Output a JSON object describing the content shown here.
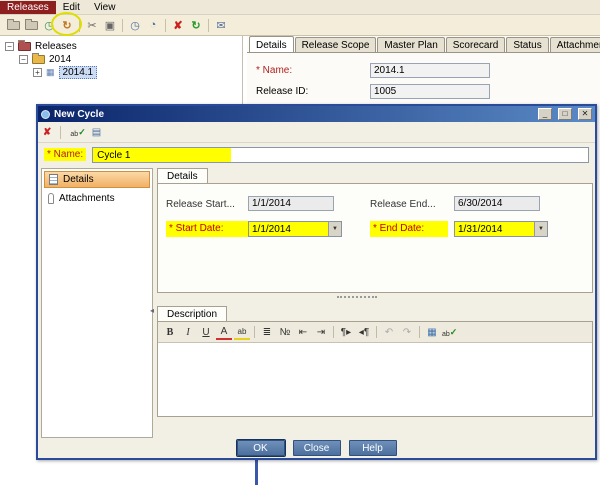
{
  "menu": {
    "releases": "Releases",
    "edit": "Edit",
    "view": "View"
  },
  "main_tabs": {
    "details": "Details",
    "release_scope": "Release Scope",
    "master_plan": "Master Plan",
    "scorecard": "Scorecard",
    "status": "Status",
    "attachments": "Attachments"
  },
  "tree": {
    "root": "Releases",
    "folder_2014": "2014",
    "release_2014_1": "2014.1"
  },
  "release_details": {
    "name_label": "* Name:",
    "name_value": "2014.1",
    "release_id_label": "Release ID:",
    "release_id_value": "1005"
  },
  "dialog": {
    "title": "New Cycle",
    "name_label": "* Name:",
    "name_value": "Cycle 1",
    "sidebar_details": "Details",
    "sidebar_attachments": "Attachments",
    "details_tab": "Details",
    "release_start_label": "Release Start...",
    "release_start_value": "1/1/2014",
    "release_end_label": "Release End...",
    "release_end_value": "6/30/2014",
    "start_date_label": "* Start Date:",
    "start_date_value": "1/1/2014",
    "end_date_label": "* End Date:",
    "end_date_value": "1/31/2014",
    "description_tab": "Description",
    "ok": "OK",
    "close": "Close",
    "help": "Help"
  },
  "editor": {
    "bold": "B",
    "italic": "I",
    "underline": "U",
    "font_color": "A",
    "highlight": "ab"
  },
  "icons": {
    "assign": "◷",
    "new_cycle": "↻",
    "cut": "✂",
    "paste": "▣",
    "time_start": "◷",
    "time_progress": "◔",
    "delete": "✘",
    "refresh": "↻",
    "send": "✉",
    "clear": "✘",
    "spell_ab": "ab",
    "spell_check": "✓",
    "thesaurus": "▤",
    "minimize": "_",
    "maximize": "□",
    "close": "✕",
    "dropdown": "▼",
    "expand_open": "−",
    "expand_closed": "+",
    "release_item": "▦",
    "bullet_list": "≣",
    "numbered_list": "№",
    "outdent": "⇤",
    "indent": "⇥",
    "ltr": "¶▸",
    "rtl": "◂¶",
    "undo": "↶",
    "redo": "↷",
    "table": "▦",
    "collapse_arrow": "◂"
  },
  "colors": {
    "highlight_yellow": "#ffff00",
    "required_red": "#b22020",
    "titlebar_blue": "#0a246a",
    "selected_item_orange": "#f2b066",
    "button_blue": "#5578ab",
    "annotation_yellow": "#dede00",
    "menu_active_maroon": "#8e1f1f"
  }
}
